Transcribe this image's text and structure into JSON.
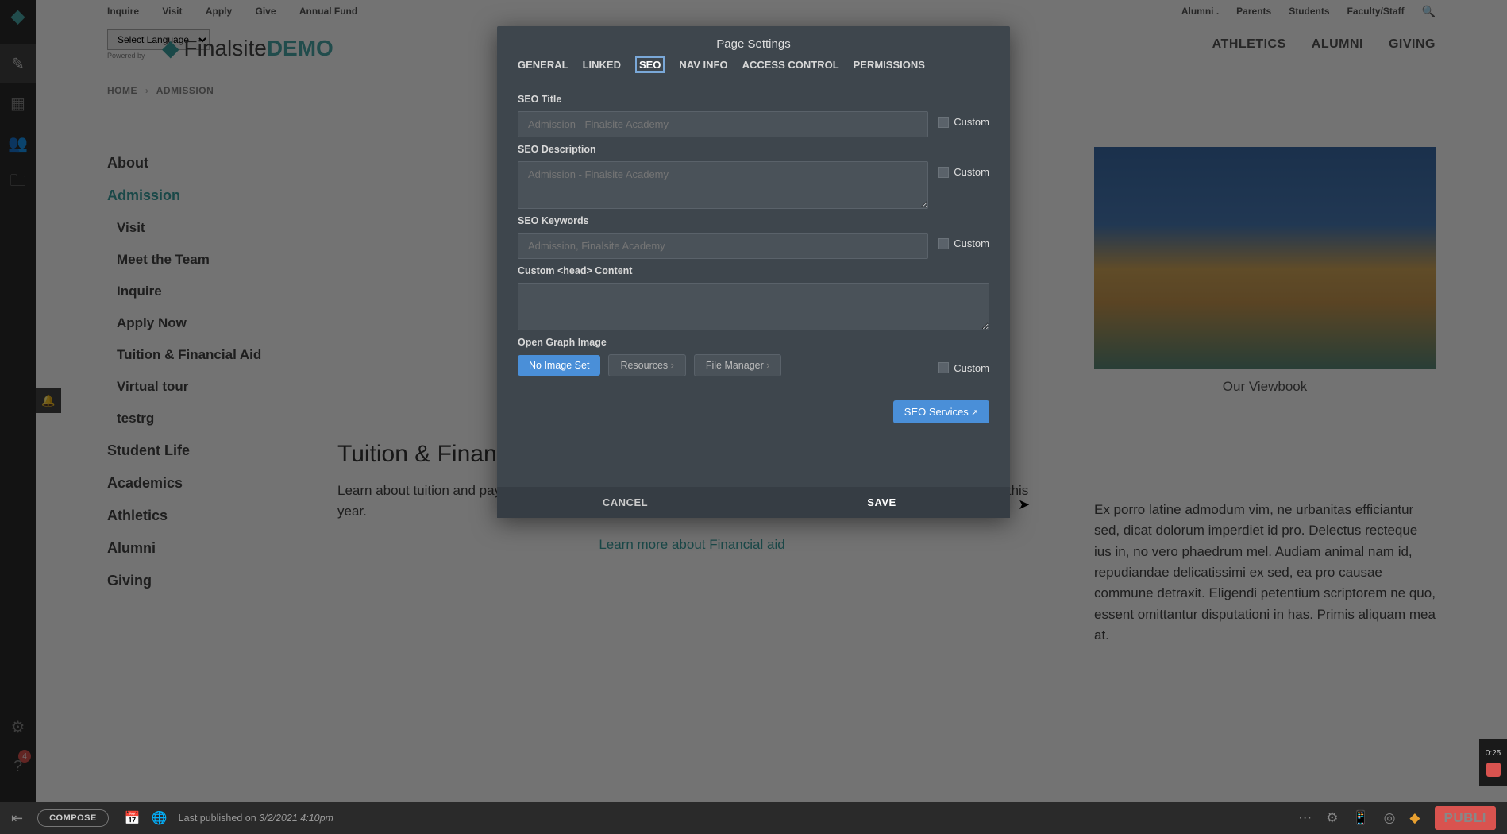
{
  "topnav": {
    "left": [
      "Inquire",
      "Visit",
      "Apply",
      "Give",
      "Annual Fund"
    ],
    "right": [
      "Alumni .",
      "Parents",
      "Students",
      "Faculty/Staff"
    ]
  },
  "lang_select": "Select Language",
  "logo": {
    "prefix": "Finalsite",
    "suffix": "DEMO"
  },
  "main_nav": [
    "ATHLETICS",
    "ALUMNI",
    "GIVING"
  ],
  "breadcrumb": {
    "home": "HOME",
    "current": "ADMISSION"
  },
  "sidenav": {
    "items": [
      {
        "label": "About",
        "sub": false
      },
      {
        "label": "Admission",
        "sub": false,
        "current": true
      },
      {
        "label": "Visit",
        "sub": true
      },
      {
        "label": "Meet the Team",
        "sub": true
      },
      {
        "label": "Inquire",
        "sub": true
      },
      {
        "label": "Apply Now",
        "sub": true
      },
      {
        "label": "Tuition & Financial Aid",
        "sub": true
      },
      {
        "label": "Virtual tour",
        "sub": true
      },
      {
        "label": "testrg",
        "sub": true
      },
      {
        "label": "Student Life",
        "sub": false
      },
      {
        "label": "Academics",
        "sub": false
      },
      {
        "label": "Athletics",
        "sub": false
      },
      {
        "label": "Alumni",
        "sub": false
      },
      {
        "label": "Giving",
        "sub": false
      }
    ]
  },
  "viewbook_caption": "Our Viewbook",
  "section": {
    "title": "Tuition & Financial Aid",
    "text": "Learn about tuition and payment plans. Finalsite is committed to providing more than $9.4 million in financial aid this year.",
    "link": "Learn more about Financial aid"
  },
  "lorem": "Ex porro latine admodum vim, ne urbanitas efficiantur sed, dicat dolorum imperdiet id pro. Delectus recteque ius in, no vero phaedrum mel. Audiam animal nam id, repudiandae delicatissimi ex sed, ea pro causae commune detraxit. Eligendi petentium scriptorem ne quo, essent omittantur disputationi in has. Primis aliquam mea at.",
  "modal": {
    "title": "Page Settings",
    "tabs": [
      "GENERAL",
      "LINKED",
      "SEO",
      "NAV INFO",
      "ACCESS CONTROL",
      "PERMISSIONS"
    ],
    "active_tab": 2,
    "fields": {
      "seo_title": {
        "label": "SEO Title",
        "placeholder": "Admission - Finalsite Academy",
        "custom": "Custom"
      },
      "seo_desc": {
        "label": "SEO Description",
        "placeholder": "Admission - Finalsite Academy",
        "custom": "Custom"
      },
      "seo_kw": {
        "label": "SEO Keywords",
        "placeholder": "Admission, Finalsite Academy",
        "custom": "Custom"
      },
      "head_content": {
        "label": "Custom <head> Content"
      },
      "og_image": {
        "label": "Open Graph Image",
        "no_image": "No Image Set",
        "resources": "Resources",
        "file_manager": "File Manager",
        "custom": "Custom"
      }
    },
    "seo_services": "SEO Services",
    "cancel": "CANCEL",
    "save": "SAVE"
  },
  "bottombar": {
    "compose": "COMPOSE",
    "published_prefix": "Last published on ",
    "published_date": "3/2/2021 4:10pm",
    "publish": "PUBLI"
  },
  "rail_badge": "4",
  "rec_time": "0:25"
}
